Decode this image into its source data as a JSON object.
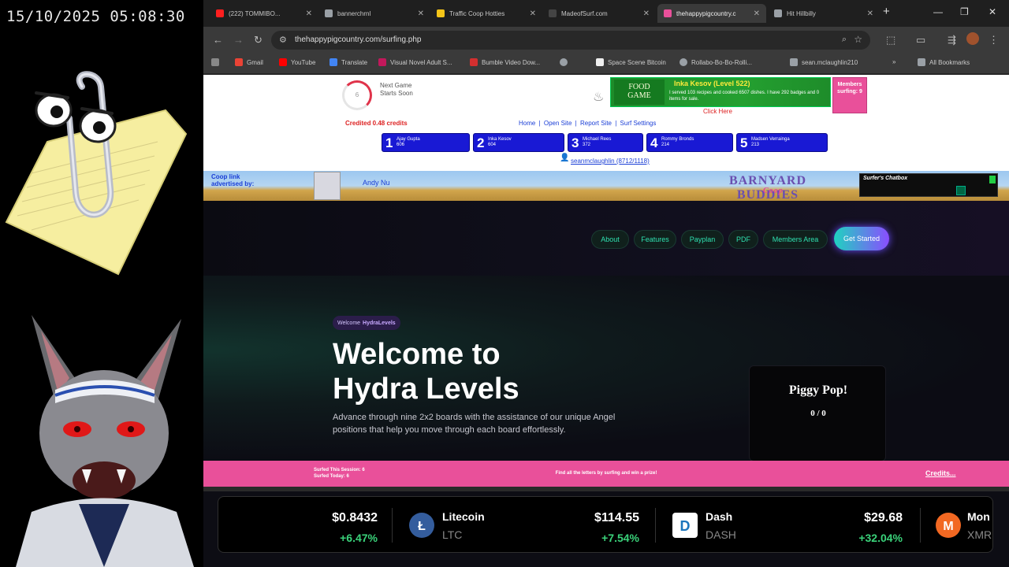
{
  "overlay": {
    "clock": "15/10/2025 05:08:30"
  },
  "tabs": [
    {
      "label": "(222) TOMMIBO...",
      "color": "#ff1f1f"
    },
    {
      "label": "bannerchrnl",
      "color": "#9aa0a6"
    },
    {
      "label": "Traffic Coop Hotties",
      "color": "#f5c518"
    },
    {
      "label": "MadeofSurf.com",
      "color": "#444444"
    },
    {
      "label": "thehappypigcountry.c",
      "color": "#e9509a"
    },
    {
      "label": "Hit Hillbilly",
      "color": "#9aa0a6"
    }
  ],
  "browser": {
    "url": "thehappypigcountry.com/surfing.php"
  },
  "bookmarks": [
    {
      "label": "Gmail",
      "color": "#ea4335"
    },
    {
      "label": "YouTube",
      "color": "#ff0000"
    },
    {
      "label": "Translate",
      "color": "#4285f4"
    },
    {
      "label": "Visual Novel Adult S...",
      "color": "#c2185b"
    },
    {
      "label": "Bumble Video Dow...",
      "color": "#d32f2f"
    },
    {
      "label": "",
      "color": "#9aa0a6"
    },
    {
      "label": "Space Scene Bitcoin",
      "color": "#eeeeee"
    },
    {
      "label": "Rollabo-Bo-Bo-Rolli...",
      "color": "#9aa0a6"
    },
    {
      "label": "sean.mclaughlin210",
      "color": "#9aa0a6"
    }
  ],
  "bookmarks_all": "All Bookmarks",
  "surf": {
    "timer_value": "6",
    "next_game": "Next Game",
    "starts_soon": "Starts Soon",
    "credited": "Credited 0.48 credits",
    "ad_logo_line1": "FOOD",
    "ad_logo_line2": "GAME",
    "ad_title": "Inka Kesov (Level 522)",
    "ad_desc": "I served 103 recipes and cooked 6507 dishes. I have 292 badges and 0 items for sale.",
    "ad_side": "Members surfing: 9",
    "click_here": "Click Here",
    "links": [
      "Home",
      "Open Site",
      "Report Site",
      "Surf Settings"
    ],
    "leaders": [
      {
        "rank": "1",
        "name": "Ajay Gupta",
        "score": "606"
      },
      {
        "rank": "2",
        "name": "Inka Kesov",
        "score": "604"
      },
      {
        "rank": "3",
        "name": "Michael Rees",
        "score": "372"
      },
      {
        "rank": "4",
        "name": "Rommy Bronds",
        "score": "214"
      },
      {
        "rank": "5",
        "name": "Madsen Verrainga",
        "score": "213"
      }
    ],
    "user_line": "seanmclaughlin (8712/1118)"
  },
  "coop": {
    "label_line1": "Coop link",
    "label_line2": "advertised by:",
    "advertiser": "Andy Nu",
    "logo": "BARNYARD BUDDIES",
    "logo_sub": "Coop",
    "chat_title": "Surfer's Chatbox"
  },
  "hydra": {
    "nav": [
      "About",
      "Features",
      "Payplan",
      "PDF",
      "Members Area"
    ],
    "cta": "Get Started",
    "badge_prefix": "Welcome",
    "badge_name": "HydraLevels",
    "title_line1": "Welcome to",
    "title_line2": "Hydra Levels",
    "desc": "Advance through nine 2x2 boards with the assistance of our unique Angel positions that help you move through each board effortlessly.",
    "piggy_title": "Piggy Pop!",
    "piggy_value": "0 / 0"
  },
  "pink": {
    "left_line1": "Surfed This Session: 6",
    "left_line2": "Surfed Today: 6",
    "middle": "Find all the letters by surfing and win a prize!",
    "right": "Credits..."
  },
  "ticker": [
    {
      "price": "$0.8432",
      "change": "+6.47%",
      "name": "Litecoin",
      "symbol": "LTC",
      "icon_color": "#345d9d"
    },
    {
      "price": "$114.55",
      "change": "+7.54%",
      "name": "Dash",
      "symbol": "DASH",
      "icon_color": "#1c75bc"
    },
    {
      "price": "$29.68",
      "change": "+32.04%",
      "name": "Mon",
      "symbol": "XMR",
      "icon_color": "#f26822"
    }
  ]
}
